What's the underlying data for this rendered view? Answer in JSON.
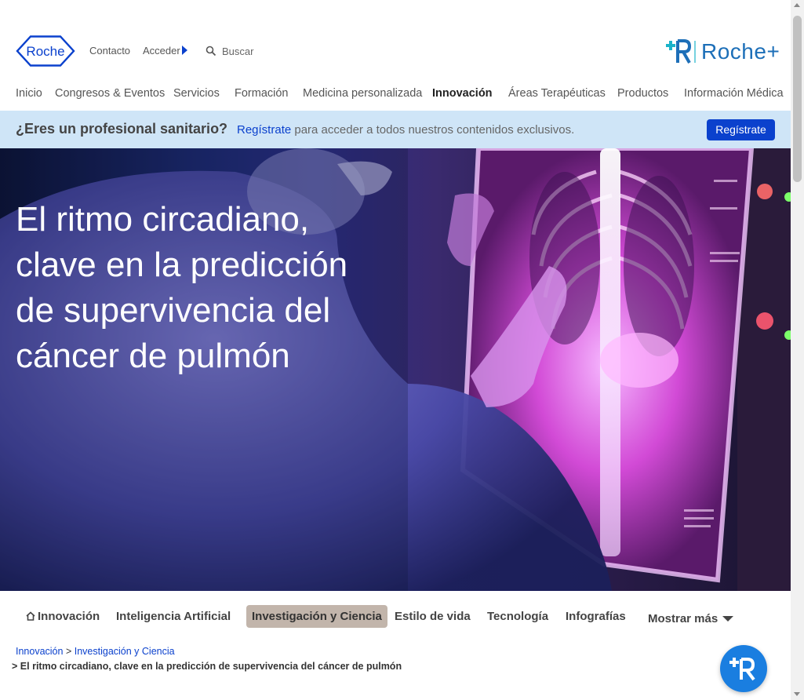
{
  "header": {
    "logo_text": "Roche",
    "contact_label": "Contacto",
    "login_label": "Acceder",
    "search_label": "Buscar",
    "rocheplus_text": "Roche+"
  },
  "main_nav": {
    "items": [
      {
        "label": "Inicio"
      },
      {
        "label": "Congresos & Eventos"
      },
      {
        "label": "Servicios"
      },
      {
        "label": "Formación"
      },
      {
        "label": "Medicina personalizada"
      },
      {
        "label": "Innovación",
        "active": true
      },
      {
        "label": "Áreas Terapéuticas"
      },
      {
        "label": "Productos"
      },
      {
        "label": "Información Médica"
      }
    ]
  },
  "banner": {
    "question": "¿Eres un profesional sanitario?",
    "link": "Regístrate",
    "text": " para acceder a todos nuestros contenidos exclusivos.",
    "button": "Regístrate"
  },
  "hero": {
    "title": "El ritmo circadiano, clave en la predicción de supervivencia del cáncer de pulmón"
  },
  "sub_nav": {
    "items": [
      {
        "label": "Innovación",
        "icon": "home-icon"
      },
      {
        "label": "Inteligencia Artificial"
      },
      {
        "label": "Investigación y Ciencia",
        "active": true
      },
      {
        "label": "Estilo de vida"
      },
      {
        "label": "Tecnología"
      },
      {
        "label": "Infografías"
      }
    ],
    "more_label": "Mostrar más"
  },
  "breadcrumb": {
    "items": [
      "Innovación",
      "Investigación y Ciencia"
    ],
    "separator": ">",
    "current": "El ritmo circadiano, clave en la predicción de supervivencia del cáncer de pulmón"
  },
  "colors": {
    "brand_blue": "#0b41cd",
    "banner_bg": "#cfe5f7",
    "active_tab_bg": "#c2b5ab",
    "fab_blue": "#1a7ee0",
    "rocheplus_teal": "#1bb3c9"
  }
}
